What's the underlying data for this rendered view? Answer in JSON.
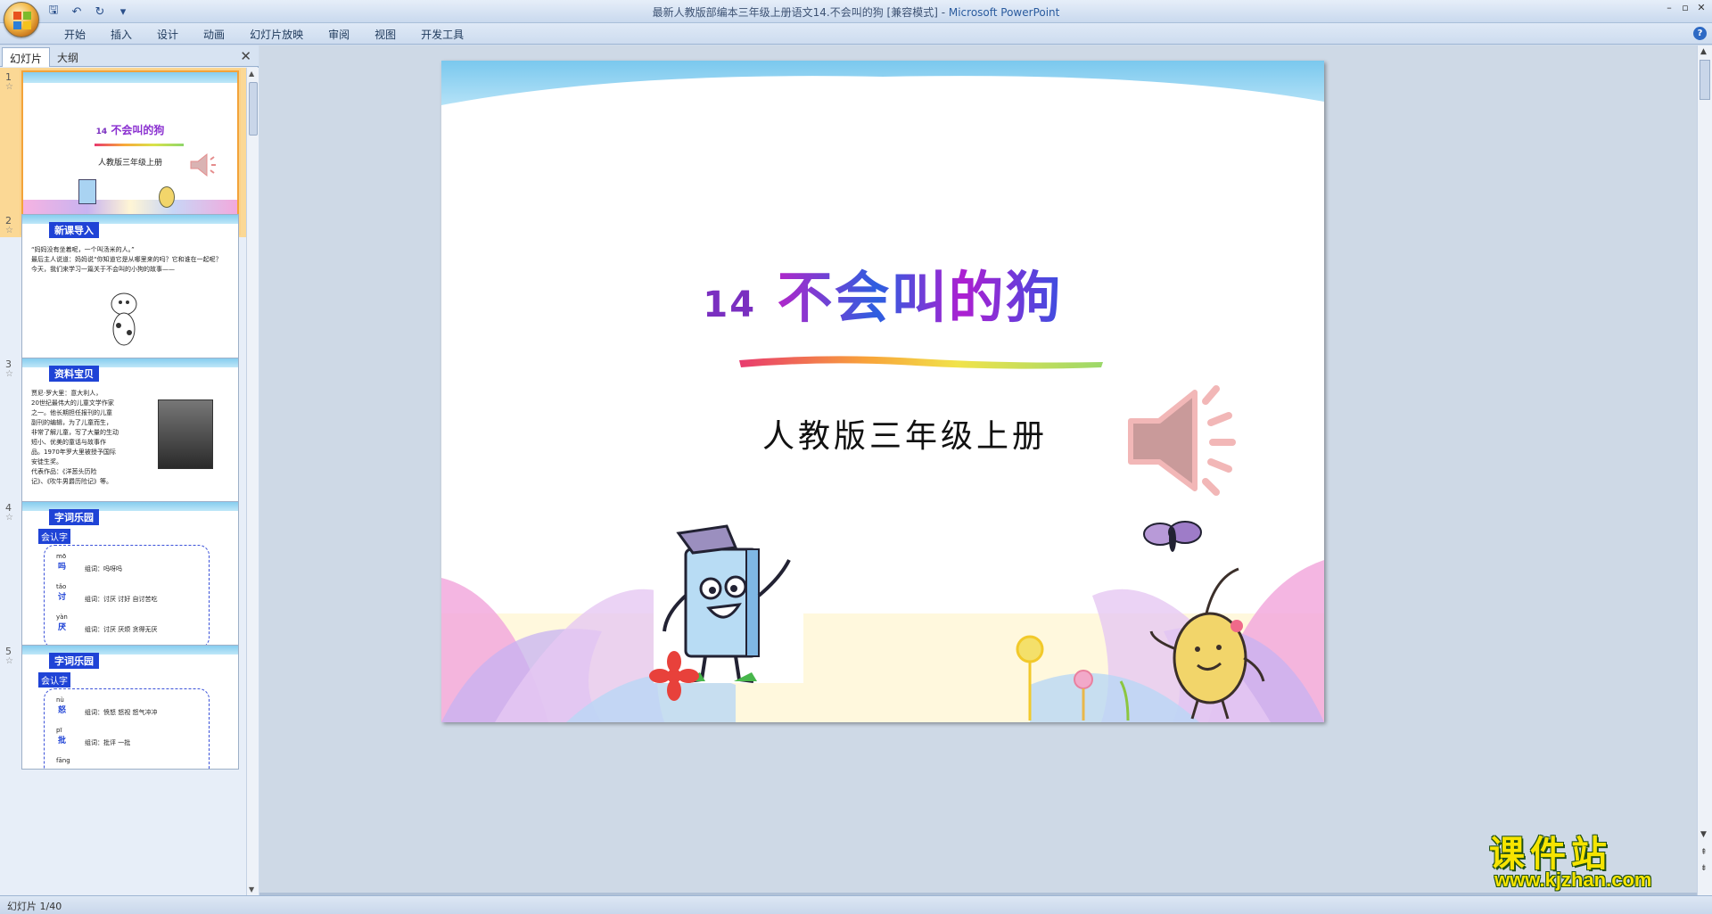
{
  "window": {
    "title": "最新人教版部编本三年级上册语文14.不会叫的狗 [兼容模式]",
    "separator": " - ",
    "app_name": "Microsoft PowerPoint",
    "controls": [
      "–",
      "▫",
      "✕"
    ]
  },
  "qat": {
    "icons": [
      "save-icon",
      "undo-icon",
      "redo-icon",
      "customize-icon"
    ],
    "glyphs": [
      "🖫",
      "↶",
      "↻",
      "▾"
    ]
  },
  "ribbon": {
    "tabs": [
      "开始",
      "插入",
      "设计",
      "动画",
      "幻灯片放映",
      "审阅",
      "视图",
      "开发工具"
    ],
    "help": "?"
  },
  "pane": {
    "tab_slides": "幻灯片",
    "tab_outline": "大纲",
    "close": "✕"
  },
  "thumbnails": [
    {
      "num": "1",
      "title_num": "14",
      "title": "不会叫的狗",
      "subtitle": "人教版三年级上册",
      "selected": true
    },
    {
      "num": "2",
      "badge": "新课导入",
      "text": "“妈妈没有坐着呢，一个叫汤米的人。”\n最后主人说道：妈妈说“你知道它是从哪里来的吗？它和谁在一起呢？\n今天，我们来学习一篇关于不会叫的小狗的故事——",
      "selected": false
    },
    {
      "num": "3",
      "badge": "资料宝贝",
      "text": "贾尼·罗大里：意大利人，\n20世纪最伟大的儿童文学作家\n之一。他长期担任报刊的儿童\n副刊的编辑，为了儿童而生，\n非常了解儿童，写了大量的生动\n短小、优美的童话与故事作\n品。1970年罗大里被授予国际\n安徒生奖。\n代表作品：《洋葱头历险\n记》、《吹牛男爵历险记》等。",
      "selected": false
    },
    {
      "num": "4",
      "badge": "字词乐园",
      "label": "会认字",
      "rows": [
        {
          "py": "mō",
          "char": "吗",
          "words": "组词：吗呀吗"
        },
        {
          "py": "tǎo",
          "char": "讨",
          "words": "组词：讨厌  讨好  自讨苦吃"
        },
        {
          "py": "yàn",
          "char": "厌",
          "words": "组词：讨厌  厌烦  贪得无厌"
        }
      ],
      "selected": false
    },
    {
      "num": "5",
      "badge": "字词乐园",
      "label": "会认字",
      "rows": [
        {
          "py": "nù",
          "char": "怒",
          "words": "组词：愤怒  怒视  怒气冲冲"
        },
        {
          "py": "pī",
          "char": "批",
          "words": "组词：批评  一批"
        },
        {
          "py": "fāng",
          "char": "",
          "words": ""
        }
      ],
      "selected": false
    }
  ],
  "slide": {
    "title_num": "14",
    "title": "不会叫的狗",
    "subtitle": "人教版三年级上册"
  },
  "status": {
    "text": "幻灯片 1/40"
  },
  "watermark": {
    "main": "课件站",
    "url": "www.kjzhan.com"
  },
  "colors": {
    "accent": "#2a5b9e",
    "selection": "#f3a33a",
    "badge_blue": "#1f43d6"
  }
}
